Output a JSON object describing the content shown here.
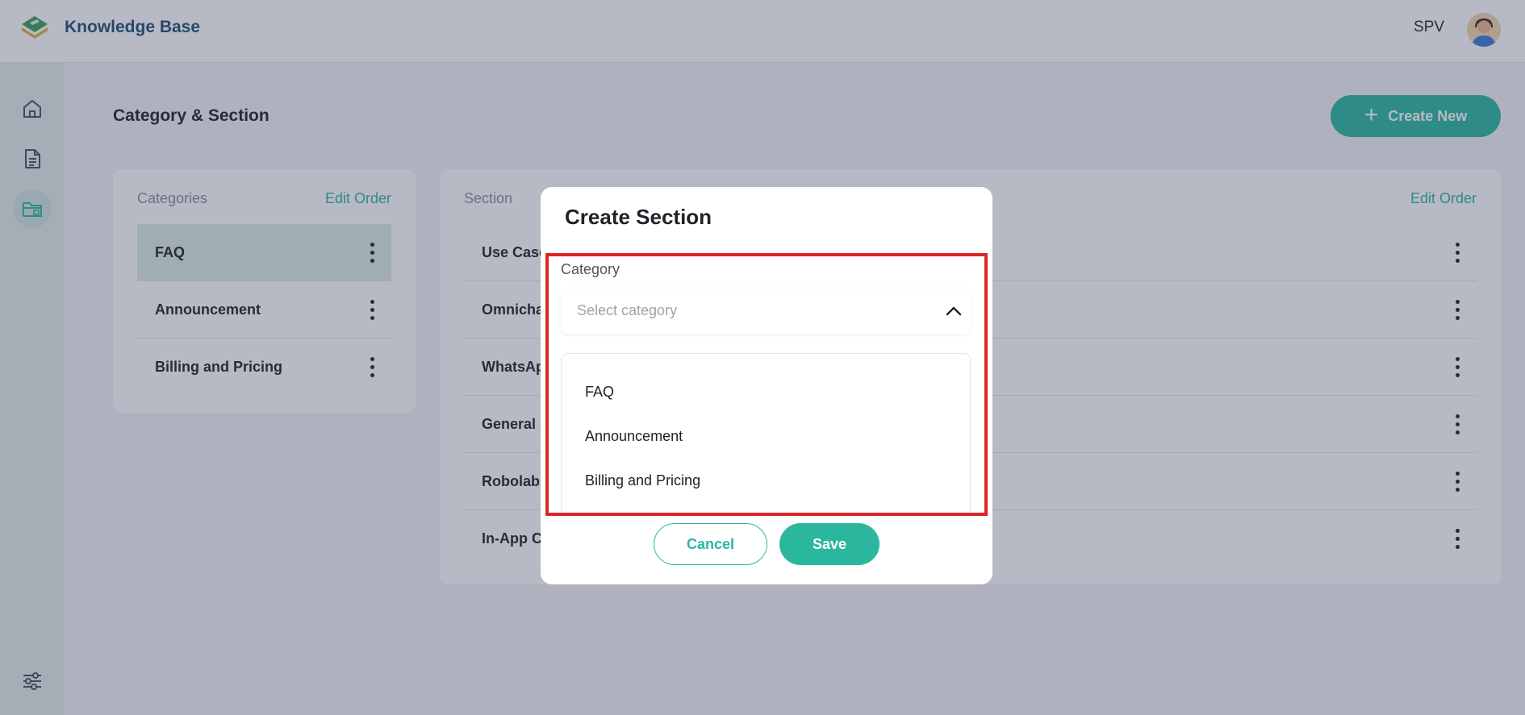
{
  "header": {
    "app_title": "Knowledge Base",
    "user_name": "SPV"
  },
  "sidebar": {
    "items": [
      {
        "icon": "home-icon"
      },
      {
        "icon": "document-icon"
      },
      {
        "icon": "folder-icon",
        "active": true
      },
      {
        "icon": "settings-sliders-icon"
      }
    ]
  },
  "page": {
    "title": "Category & Section",
    "create_new_label": "Create New",
    "create_new_icon": "plus-icon"
  },
  "categories": {
    "heading": "Categories",
    "edit_order_label": "Edit Order",
    "items": [
      "FAQ",
      "Announcement",
      "Billing and Pricing"
    ],
    "selected": "FAQ"
  },
  "sections": {
    "heading": "Section",
    "edit_order_label": "Edit Order",
    "items": [
      "Use Case",
      "Omnicha",
      "WhatsAp",
      "General S",
      "Robolabs",
      "In-App C"
    ]
  },
  "modal": {
    "title": "Create Section",
    "category_label": "Category",
    "category_placeholder": "Select category",
    "options": [
      "FAQ",
      "Announcement",
      "Billing and Pricing"
    ],
    "cancel_label": "Cancel",
    "save_label": "Save"
  },
  "colors": {
    "accent": "#2bb79d",
    "brand_title": "#1d4f72",
    "highlight": "#d92626"
  }
}
